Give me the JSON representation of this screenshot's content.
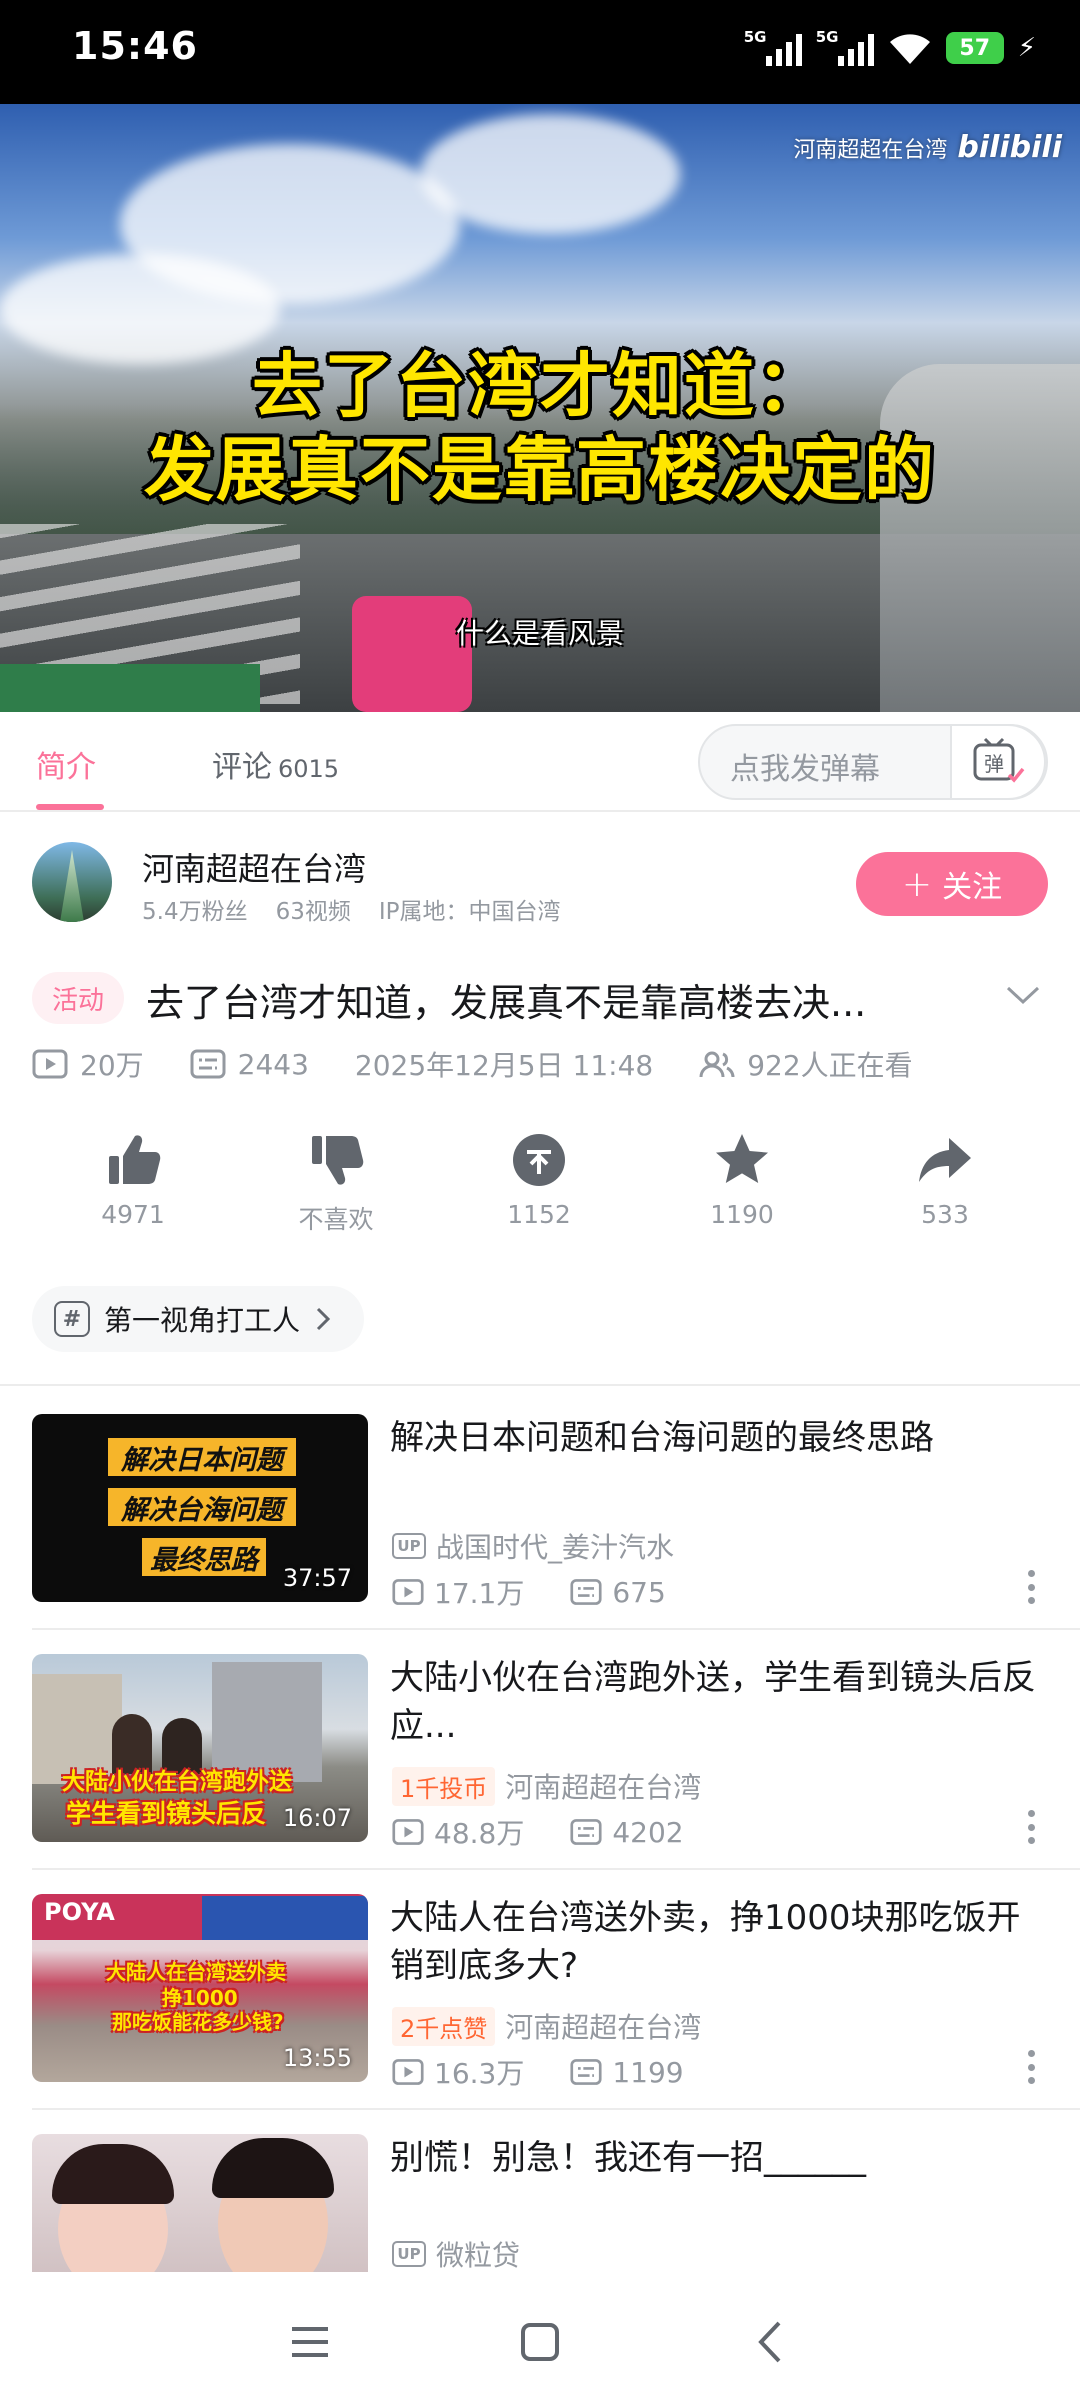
{
  "status_bar": {
    "time": "15:46",
    "network_1": "5G",
    "network_2": "5G",
    "battery": "57"
  },
  "video": {
    "watermark_channel": "河南超超在台湾",
    "watermark_brand": "bilibili",
    "overlay_title_line1": "去了台湾才知道：",
    "overlay_title_line2": "发展真不是靠高楼决定的",
    "subtitle": "什么是看风景"
  },
  "tabs": {
    "intro": "简介",
    "comments": "评论",
    "comments_count": "6015",
    "danmaku_placeholder": "点我发弹幕"
  },
  "uploader": {
    "name": "河南超超在台湾",
    "fans": "5.4万粉丝",
    "videos": "63视频",
    "ip": "IP属地：中国台湾",
    "follow_label": "关注"
  },
  "detail": {
    "badge": "活动",
    "title": "去了台湾才知道，发展真不是靠高楼去决...",
    "views": "20万",
    "danmaku_count": "2443",
    "date": "2025年12月5日 11:48",
    "watching": "922人正在看"
  },
  "actions": {
    "like": "4971",
    "dislike": "不喜欢",
    "coin": "1152",
    "favorite": "1190",
    "share": "533"
  },
  "tag": "第一视角打工人",
  "recommendations": [
    {
      "title": "解决日本问题和台海问题的最终思路",
      "uploader": "战国时代_姜汁汽水",
      "hot": "",
      "views": "17.1万",
      "danmaku": "675",
      "duration": "37:57",
      "thumb_lines": [
        "解决日本问题",
        "解决台海问题",
        "最终思路"
      ]
    },
    {
      "title": "大陆小伙在台湾跑外送，学生看到镜头后反应...",
      "uploader": "河南超超在台湾",
      "hot": "1千投币",
      "views": "48.8万",
      "danmaku": "4202",
      "duration": "16:07",
      "thumb_lines": [
        "大陆小伙在台湾跑外送",
        "学生看到镜头后反"
      ]
    },
    {
      "title": "大陆人在台湾送外卖，挣1000块那吃饭开销到底多大?",
      "uploader": "河南超超在台湾",
      "hot": "2千点赞",
      "views": "16.3万",
      "danmaku": "1199",
      "duration": "13:55",
      "thumb_lines": [
        "大陆人在台湾送外卖",
        "挣1000",
        "那吃饭能花多少钱?"
      ]
    },
    {
      "title": "别慌！别急！我还有一招______",
      "uploader": "微粒贷",
      "hot": "",
      "views": "",
      "danmaku": "",
      "duration": "",
      "thumb_lines": []
    }
  ],
  "colors": {
    "accent": "#fb7299",
    "muted": "#9499a0",
    "text": "#18191c"
  }
}
